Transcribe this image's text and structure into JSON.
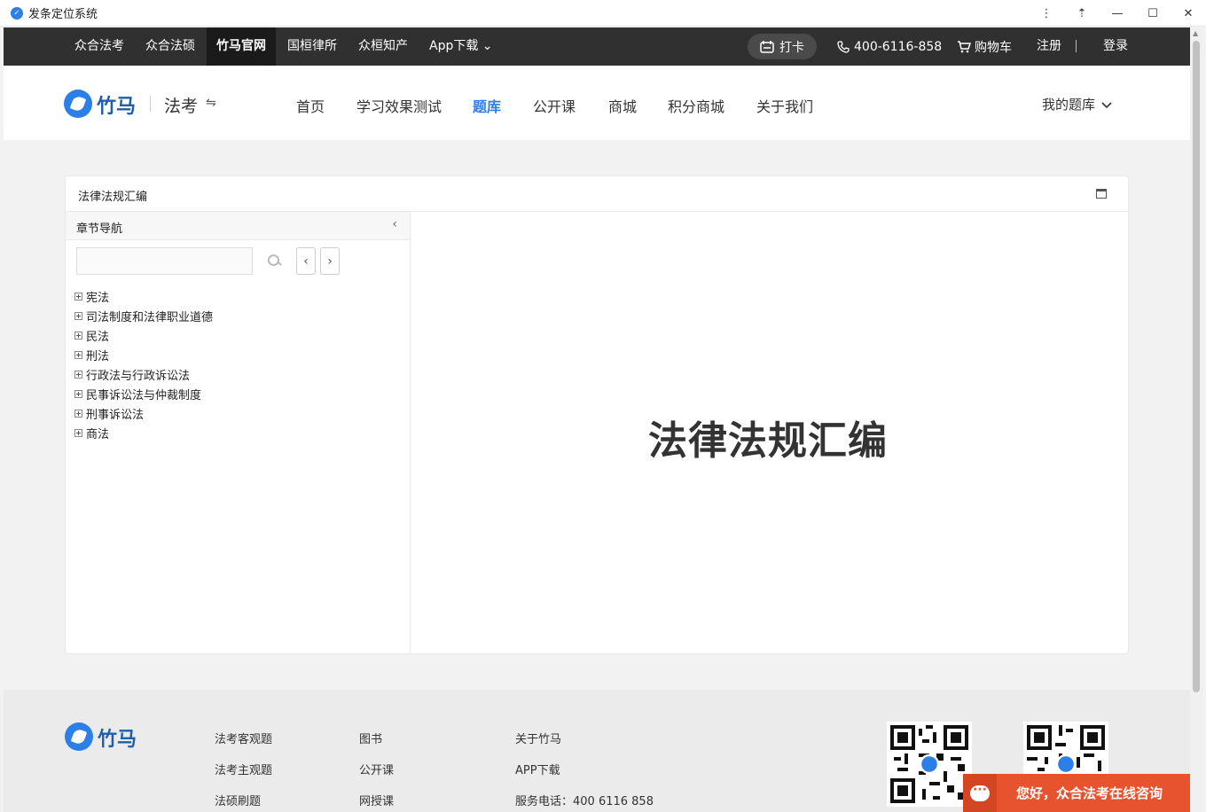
{
  "window": {
    "title": "发条定位系统",
    "controls": {
      "more": "⋮",
      "pin": "⇡",
      "minimize": "—",
      "maximize": "☐",
      "close": "✕"
    }
  },
  "topbar": {
    "links": [
      "众合法考",
      "众合法硕",
      "竹马官网",
      "国桓律所",
      "众桓知产",
      "App下载 ⌄"
    ],
    "active_link": "竹马官网",
    "checkin": "打卡",
    "phone": "400-6116-858",
    "cart": "购物车",
    "register": "注册",
    "login": "登录"
  },
  "header": {
    "logo_text": "竹马",
    "subject": "法考",
    "nav": [
      "首页",
      "学习效果测试",
      "题库",
      "公开课",
      "商城",
      "积分商城",
      "关于我们"
    ],
    "active_nav": "题库",
    "my_bank": "我的题库"
  },
  "card": {
    "title": "法律法规汇编",
    "sidebar_title": "章节导航",
    "search_placeholder": "",
    "tree": [
      "宪法",
      "司法制度和法律职业道德",
      "民法",
      "刑法",
      "行政法与行政诉讼法",
      "民事诉讼法与仲裁制度",
      "刑事诉讼法",
      "商法"
    ],
    "main_title": "法律法规汇编"
  },
  "footer": {
    "logo_text": "竹马",
    "col1": [
      "法考客观题",
      "法考主观题",
      "法硕刷题"
    ],
    "col2": [
      "图书",
      "公开课",
      "网授课"
    ],
    "col3": [
      "关于竹马",
      "APP下载",
      "服务电话：400 6116 858"
    ]
  },
  "chat": {
    "text": "您好，众合法考在线咨询"
  },
  "colors": {
    "accent": "#2b7fe6",
    "topbar": "#303030",
    "chat": "#e8532f"
  }
}
